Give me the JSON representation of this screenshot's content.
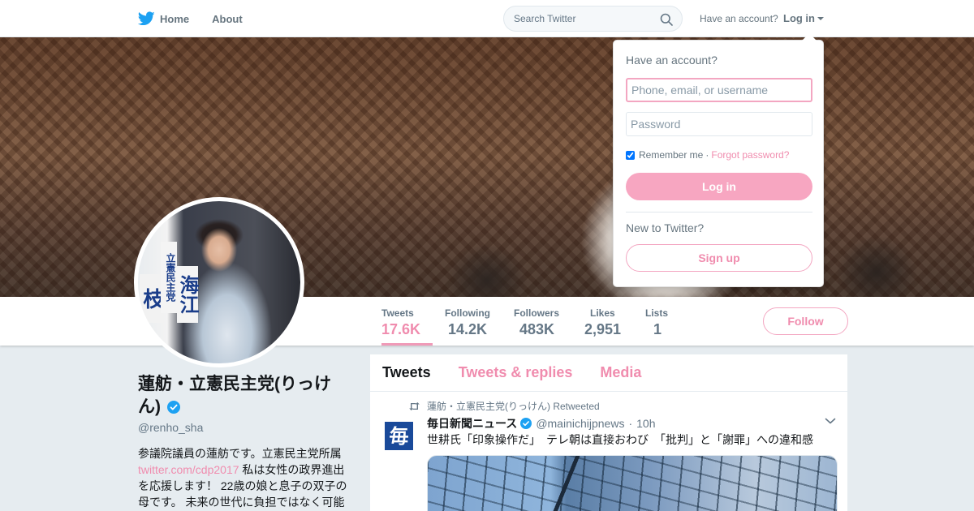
{
  "nav": {
    "home_label": "Home",
    "about_label": "About",
    "search_placeholder": "Search Twitter",
    "have_account": "Have an account?",
    "login_label": "Log in"
  },
  "profile": {
    "name": "蓮舫・立憲民主党(りっけん)",
    "handle": "@renho_sha",
    "bio_part1": "参議院議員の蓮舫です。立憲民主党所属",
    "bio_link": "twitter.com/cdp2017",
    "bio_part2": " 私は女性の政界進出を応援します！ 22歳の娘と息子の双子の母です。 未来の世代に負担ではなく可能",
    "avatar_sign_left": "枝",
    "avatar_sign_right": "立憲民主党",
    "avatar_sign_right2": "海江"
  },
  "stats": [
    {
      "label": "Tweets",
      "value": "17.6K"
    },
    {
      "label": "Following",
      "value": "14.2K"
    },
    {
      "label": "Followers",
      "value": "483K"
    },
    {
      "label": "Likes",
      "value": "2,951"
    },
    {
      "label": "Lists",
      "value": "1"
    }
  ],
  "follow_label": "Follow",
  "tabs": [
    {
      "label": "Tweets"
    },
    {
      "label": "Tweets & replies"
    },
    {
      "label": "Media"
    }
  ],
  "tweet": {
    "retweeted_by": "蓮舫・立憲民主党(りっけん) Retweeted",
    "avatar_glyph": "毎",
    "author_name": "毎日新聞ニュース",
    "author_handle": "@mainichijpnews",
    "separator": "·",
    "time": "10h",
    "text": "世耕氏「印象操作だ」　テレ朝は直接おわび　「批判」と「謝罪」への違和感"
  },
  "login_dropdown": {
    "title": "Have an account?",
    "username_placeholder": "Phone, email, or username",
    "password_placeholder": "Password",
    "remember_label": "Remember me",
    "dot": "·",
    "forgot_label": "Forgot password?",
    "login_button": "Log in",
    "new_label": "New to Twitter?",
    "signup_button": "Sign up"
  },
  "colors": {
    "accent_pink": "#f08cae",
    "twitter_blue": "#1da1f2",
    "page_bg": "#e6ecf0"
  },
  "icons": [
    "twitter-bird-icon",
    "search-icon",
    "caret-down-icon",
    "verified-icon",
    "retweet-icon",
    "chevron-down-icon"
  ]
}
